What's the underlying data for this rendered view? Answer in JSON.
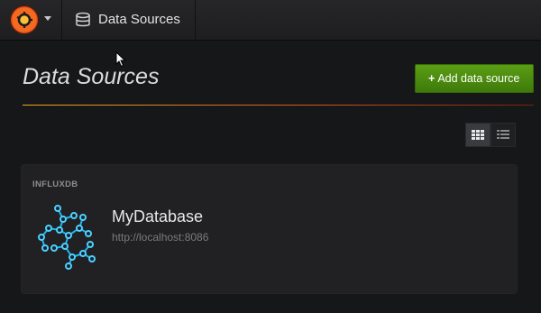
{
  "topbar": {
    "logo_icon": "grafana-logo-icon",
    "breadcrumb": {
      "icon": "database-icon",
      "title": "Data Sources"
    }
  },
  "page": {
    "title": "Data Sources",
    "add_button": {
      "icon": "plus-icon",
      "label": "Add data source"
    },
    "accent_gradient": [
      "#f1a521",
      "#d9581a",
      "#7a1f10"
    ]
  },
  "view_toggle": {
    "options": [
      "grid-view-icon",
      "list-view-icon"
    ],
    "selected": "grid"
  },
  "datasources": [
    {
      "type": "INFLUXDB",
      "name": "MyDatabase",
      "url": "http://localhost:8086",
      "icon": "influxdb-icon"
    }
  ],
  "colors": {
    "button_green": "#4a8c10",
    "influx_cyan": "#22b5e8"
  }
}
